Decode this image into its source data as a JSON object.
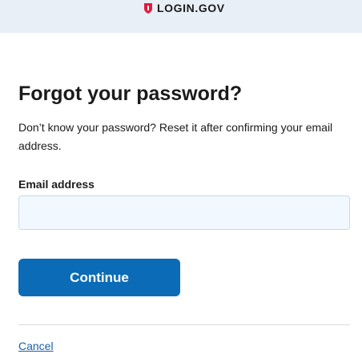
{
  "header": {
    "logo_text": "LOGIN.GOV",
    "logo_icon": "shield-icon",
    "background_color": "#e8eff7",
    "shield_color": "#e21c3d"
  },
  "main": {
    "title": "Forgot your password?",
    "description": "Don’t know your password? Reset it after confirming your email address.",
    "email_label": "Email address",
    "email_value": "",
    "continue_label": "Continue",
    "cancel_label": "Cancel"
  },
  "colors": {
    "primary_button": "#0b6bb6",
    "link": "#1a5fa8",
    "input_background": "#f1f8ff"
  }
}
